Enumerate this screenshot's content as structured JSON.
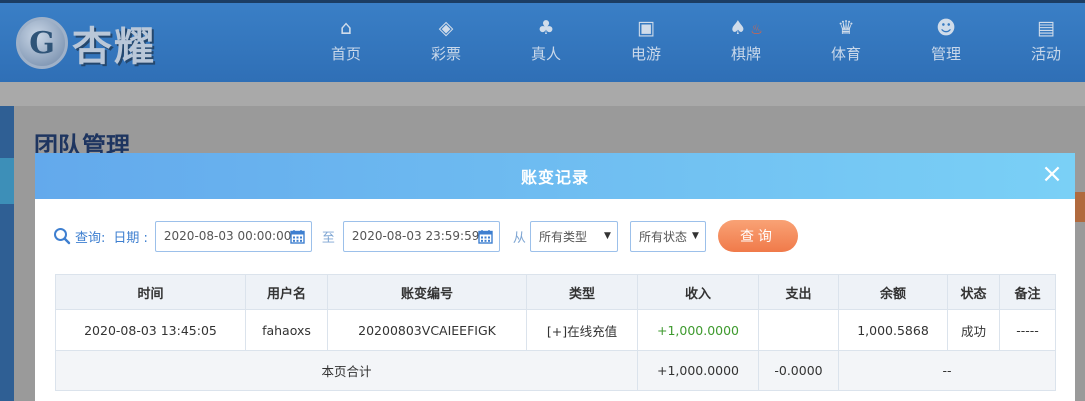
{
  "brand": {
    "logo_text": "杏耀",
    "logo_mark": "G"
  },
  "nav": [
    {
      "label": "首页",
      "icon": "home-icon",
      "glyph": "⌂"
    },
    {
      "label": "彩票",
      "icon": "lottery-icon",
      "glyph": "◈"
    },
    {
      "label": "真人",
      "icon": "live-dealer-icon",
      "glyph": "♣"
    },
    {
      "label": "电游",
      "icon": "slot-icon",
      "glyph": "▣"
    },
    {
      "label": "棋牌",
      "icon": "cards-icon",
      "glyph": "♠"
    },
    {
      "label": "体育",
      "icon": "trophy-icon",
      "glyph": "♛"
    },
    {
      "label": "管理",
      "icon": "users-icon",
      "glyph": "☻"
    },
    {
      "label": "活动",
      "icon": "gift-icon",
      "glyph": "▤"
    }
  ],
  "page": {
    "title": "团队管理"
  },
  "modal": {
    "title": "账变记录",
    "close_label": "×",
    "query": {
      "label": "查询:",
      "date_label": "日期 :",
      "start_date": "2020-08-03 00:00:00",
      "range_sep": "至",
      "end_date": "2020-08-03 23:59:59",
      "from_label": "从",
      "type_select": "所有类型",
      "status_select": "所有状态",
      "button": "查询"
    },
    "table": {
      "headers": [
        "时间",
        "用户名",
        "账变编号",
        "类型",
        "收入",
        "支出",
        "余额",
        "状态",
        "备注"
      ],
      "rows": [
        {
          "time": "2020-08-03 13:45:05",
          "username": "fahaoxs",
          "txn_id": "20200803VCAIEEFIGK",
          "type": "[+]在线充值",
          "income": "+1,000.0000",
          "expense": "",
          "balance": "1,000.5868",
          "status": "成功",
          "note": "-----"
        }
      ],
      "summary": {
        "label": "本页合计",
        "income": "+1,000.0000",
        "expense": "-0.0000",
        "balance": "--"
      }
    }
  },
  "colors": {
    "income": "#3e9a2e",
    "accent": "#3e7fd0",
    "button": "#f07a4a"
  }
}
